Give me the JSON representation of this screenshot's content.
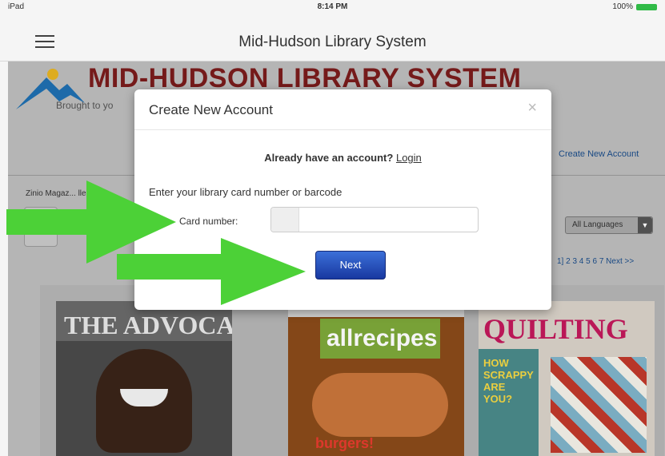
{
  "status_bar": {
    "carrier": "iPad",
    "time": "8:14 PM",
    "battery": "100%"
  },
  "navbar": {
    "title": "Mid-Hudson Library System",
    "menu_icon": "hamburger-icon"
  },
  "page": {
    "logo_title": "MID-HUDSON LIBRARY SYSTEM",
    "logo_tagline": "Brought to yo",
    "create_account_link": "Create New Account",
    "zinio_label": "Zinio Magaz... llect",
    "language_select": "All Languages",
    "pager": "1] 2 3 4 5 6 7 Next >>",
    "magazines": [
      {
        "title": "THE ADVOCATE"
      },
      {
        "title": "allrecipes",
        "sub": "burgers!"
      },
      {
        "title": "QUILTING",
        "sub": "HOW SCRAPPY ARE YOU?"
      }
    ]
  },
  "modal": {
    "title": "Create New Account",
    "close": "×",
    "already_text": "Already have an account?",
    "login_link": "Login",
    "instruction": "Enter your library card number or barcode",
    "card_label": "Card number:",
    "card_value": "",
    "next_label": "Next"
  },
  "colors": {
    "arrow": "#4cd137",
    "button": "#1f45b5",
    "logo": "#7a1c1c",
    "link": "#1b4d8a"
  }
}
